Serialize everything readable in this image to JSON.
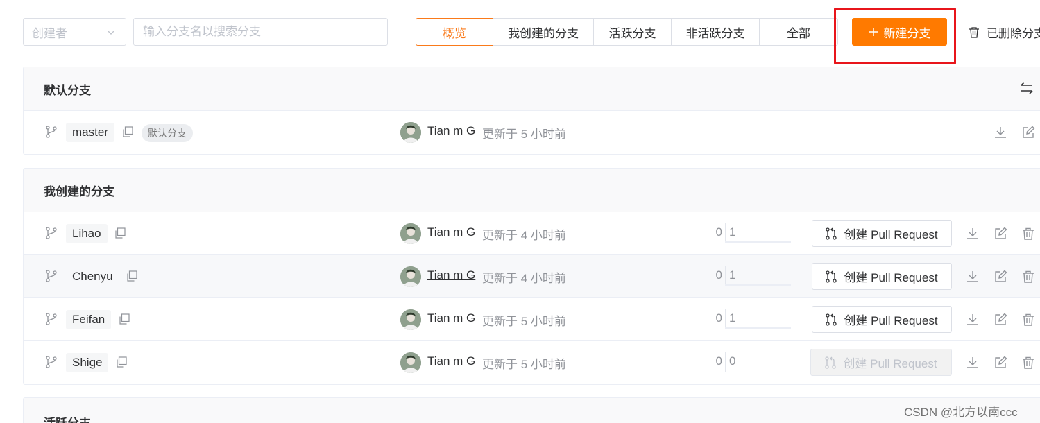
{
  "toolbar": {
    "creator_placeholder": "创建者",
    "search_placeholder": "输入分支名以搜索分支",
    "tabs": [
      {
        "label": "概览",
        "active": true
      },
      {
        "label": "我创建的分支",
        "active": false
      },
      {
        "label": "活跃分支",
        "active": false
      },
      {
        "label": "非活跃分支",
        "active": false
      },
      {
        "label": "全部",
        "active": false
      }
    ],
    "new_branch_label": "新建分支",
    "deleted_branches_label": "已删除分支"
  },
  "sections": {
    "default": {
      "title": "默认分支",
      "rows": [
        {
          "branch": "master",
          "badge": "默认分支",
          "author": "Tian m G",
          "updated": "更新于 5 小时前"
        }
      ]
    },
    "mine": {
      "title": "我创建的分支",
      "rows": [
        {
          "branch": "Lihao",
          "author": "Tian m G",
          "updated": "更新于 4 小时前",
          "ahead": "0",
          "behind": "1",
          "pr_label": "创建 Pull Request"
        },
        {
          "branch": "Chenyu",
          "author": "Tian m G",
          "updated": "更新于 4 小时前",
          "ahead": "0",
          "behind": "1",
          "pr_label": "创建 Pull Request"
        },
        {
          "branch": "Feifan",
          "author": "Tian m G",
          "updated": "更新于 5 小时前",
          "ahead": "0",
          "behind": "1",
          "pr_label": "创建 Pull Request"
        },
        {
          "branch": "Shige",
          "author": "Tian m G",
          "updated": "更新于 5 小时前",
          "ahead": "0",
          "behind": "0",
          "pr_label": "创建 Pull Request"
        }
      ]
    },
    "active": {
      "title": "活跃分支"
    }
  },
  "watermark": "CSDN @北方以南ccc",
  "colors": {
    "accent": "#ff7a00",
    "highlight_border": "#e8151b"
  }
}
